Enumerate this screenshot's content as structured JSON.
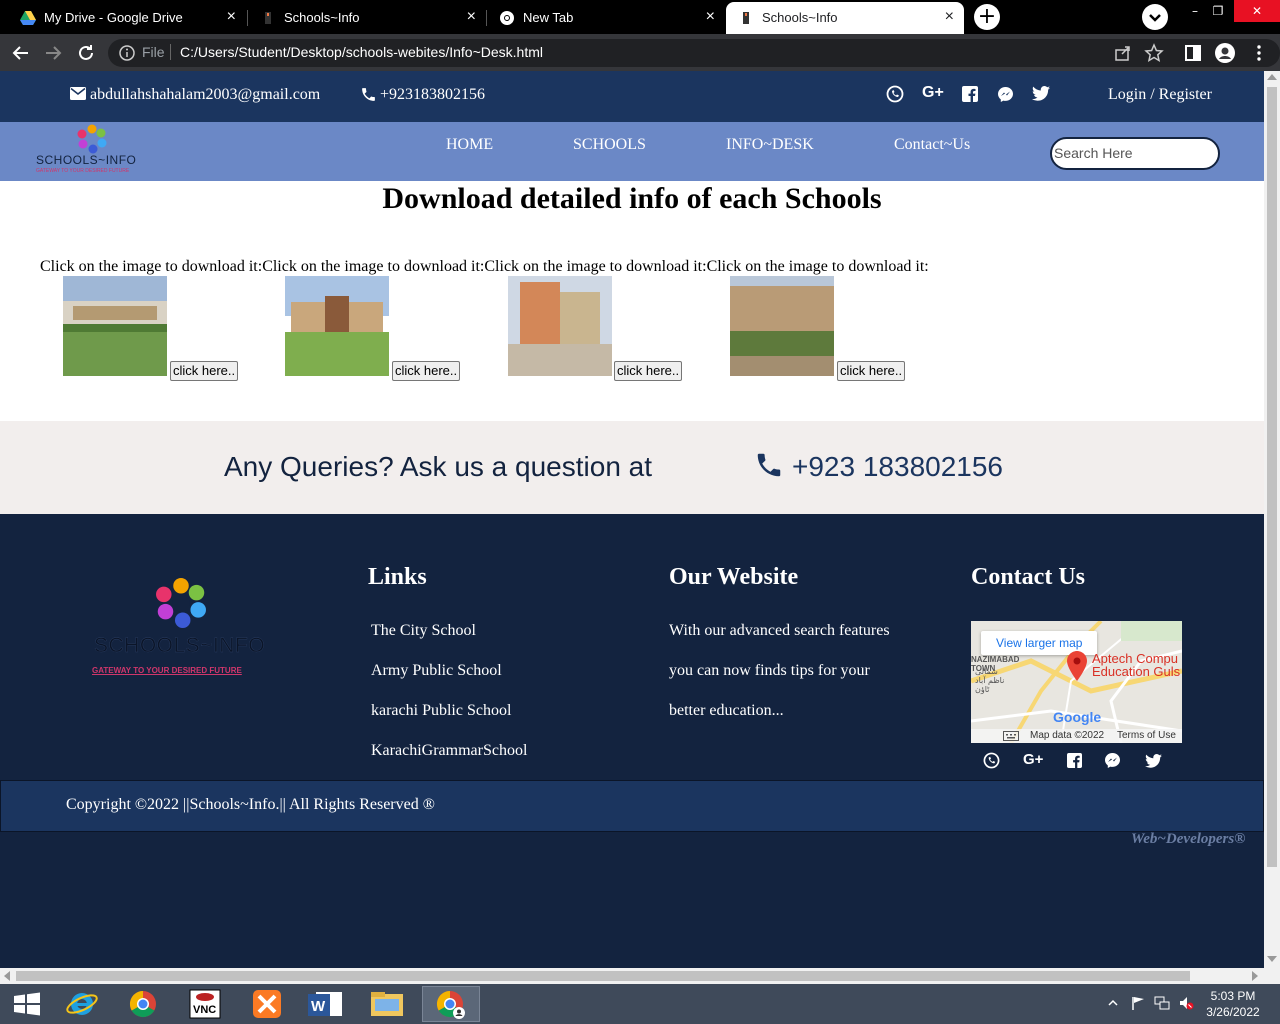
{
  "browser": {
    "tabs": [
      {
        "title": "My Drive - Google Drive",
        "active": false
      },
      {
        "title": "Schools~Info",
        "active": false
      },
      {
        "title": "New Tab",
        "active": false
      },
      {
        "title": "Schools~Info",
        "active": true
      }
    ],
    "address": {
      "scheme_label": "File",
      "url": "C:/Users/Student/Desktop/schools-webites/Info~Desk.html"
    }
  },
  "topbar": {
    "email": "abdullahshahalam2003@gmail.com",
    "phone": "+923183802156",
    "login": "Login / Register",
    "social_icons": [
      "viber-icon",
      "google-plus-icon",
      "facebook-icon",
      "messenger-icon",
      "twitter-icon"
    ]
  },
  "navbar": {
    "logo_text": "SCHOOLS~INFO",
    "logo_tagline": "GATEWAY TO YOUR DESIRED FUTURE",
    "links": [
      "HOME",
      "SCHOOLS",
      "INFO~DESK",
      "Contact~Us"
    ],
    "search_placeholder": "Search Here"
  },
  "main": {
    "title": "Download detailed info of each Schools",
    "instruction": "Click on the image to download it:Click on the image to download it:Click on the image to download it:Click on the image to download it:",
    "downloads": [
      {
        "button": "click here.."
      },
      {
        "button": "click here.."
      },
      {
        "button": "click here.."
      },
      {
        "button": "click here.."
      }
    ]
  },
  "queries": {
    "text": "Any Queries? Ask us a question at",
    "phone": "+923 183802156"
  },
  "footer": {
    "logo_text": "SCHOOLS~INFO",
    "logo_tagline": "GATEWAY TO YOUR DESIRED FUTURE",
    "links_heading": "Links",
    "links": [
      "The City School",
      "Army Public School",
      "karachi Public School",
      "KarachiGrammarSchool"
    ],
    "website_heading": "Our Website",
    "website_lines": [
      "With our advanced search features",
      "you can now finds tips for your",
      "better education..."
    ],
    "contact_heading": "Contact Us",
    "map": {
      "larger_map": "View larger map",
      "place": "Aptech Compu Education Guls",
      "area": "NAZIMABAD TOWN",
      "area_urdu": "شمالی ناظم آباد ٹاؤن",
      "brand": "Google",
      "attribution": "Map data ©2022",
      "terms": "Terms of Use"
    },
    "copyright": "Copyright ©2022 ||Schools~Info.|| All Rights Reserved ®",
    "credit": "Web~Developers®"
  },
  "taskbar": {
    "apps": [
      "start-icon",
      "internet-explorer-icon",
      "chrome-icon",
      "vnc-viewer-icon",
      "xampp-icon",
      "word-icon",
      "file-explorer-icon",
      "chrome-profile-icon"
    ],
    "time": "5:03 PM",
    "date": "3/26/2022"
  }
}
